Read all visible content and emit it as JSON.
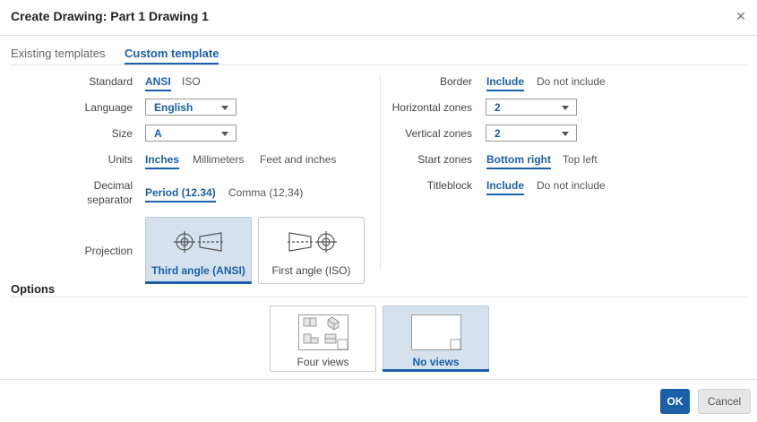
{
  "dialog": {
    "title": "Create Drawing: Part 1 Drawing 1"
  },
  "tabs": [
    {
      "label": "Existing templates",
      "active": false
    },
    {
      "label": "Custom template",
      "active": true
    }
  ],
  "left": {
    "standard": {
      "label": "Standard",
      "options": [
        "ANSI",
        "ISO"
      ],
      "selected": "ANSI"
    },
    "language": {
      "label": "Language",
      "value": "English"
    },
    "size": {
      "label": "Size",
      "value": "A"
    },
    "units": {
      "label": "Units",
      "options": [
        "Inches",
        "Millimeters",
        "Feet and inches"
      ],
      "selected": "Inches"
    },
    "decimal": {
      "label_line1": "Decimal",
      "label_line2": "separator",
      "options": [
        "Period (12.34)",
        "Comma (12,34)"
      ],
      "selected": "Period (12.34)"
    },
    "projection": {
      "label": "Projection",
      "options": [
        "Third angle (ANSI)",
        "First angle (ISO)"
      ],
      "selected": "Third angle (ANSI)"
    }
  },
  "right": {
    "border": {
      "label": "Border",
      "options": [
        "Include",
        "Do not include"
      ],
      "selected": "Include"
    },
    "horizontal_zones": {
      "label": "Horizontal zones",
      "value": "2"
    },
    "vertical_zones": {
      "label": "Vertical zones",
      "value": "2"
    },
    "start_zones": {
      "label": "Start zones",
      "options": [
        "Bottom right",
        "Top left"
      ],
      "selected": "Bottom right"
    },
    "titleblock": {
      "label": "Titleblock",
      "options": [
        "Include",
        "Do not include"
      ],
      "selected": "Include"
    }
  },
  "options": {
    "title": "Options",
    "views": [
      "Four views",
      "No views"
    ],
    "selected": "No views"
  },
  "footer": {
    "ok_label": "OK",
    "cancel_label": "Cancel"
  },
  "icons": {
    "close": "close-icon",
    "dropdown": "chevron-down-icon",
    "third_angle": "third-angle-projection-icon",
    "first_angle": "first-angle-projection-icon",
    "four_views": "four-views-thumbnail",
    "no_views": "blank-sheet-thumbnail"
  },
  "colors": {
    "accent": "#1a5fa8",
    "selected_card": "#d5e1ed",
    "ok_button": "#1a5fa8"
  }
}
